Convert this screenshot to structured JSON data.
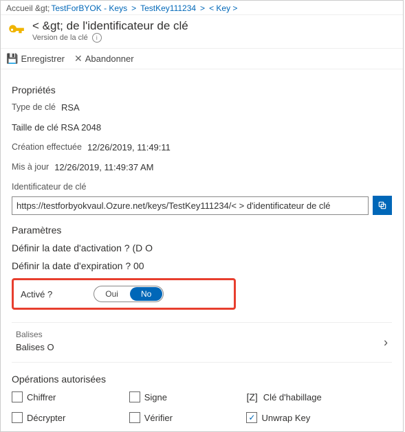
{
  "breadcrumb": {
    "home": "Accueil &gt;",
    "vault": "TestForBYOK - Keys",
    "key": "TestKey111234",
    "current": "< Key >"
  },
  "title": {
    "main": "< &gt; de l'identificateur de clé",
    "sub": "Version de la clé"
  },
  "cmdbar": {
    "save": "Enregistrer",
    "discard": "Abandonner"
  },
  "properties": {
    "heading": "Propriétés",
    "key_type_label": "Type de clé",
    "key_type_value": "RSA",
    "key_size_line": "Taille de clé RSA 2048",
    "created_label": "Création effectuée",
    "created_value": "12/26/2019, 11:49:11",
    "updated_label": "Mis à jour",
    "updated_value": "12/26/2019, 11:49:37 AM",
    "id_label": "Identificateur de clé",
    "id_value": "https://testforbyokvaul.Ozure.net/keys/TestKey111234/< > d'identificateur de clé"
  },
  "settings": {
    "heading": "Paramètres",
    "activation_line": "Définir la date d'activation ? (D O",
    "expiration_line": "Définir la date d'expiration ? 00",
    "enabled_label": "Activé ?",
    "toggle_yes": "Oui",
    "toggle_no": "No"
  },
  "tags": {
    "label": "Balises",
    "value": "Balises O"
  },
  "operations": {
    "heading": "Opérations autorisées",
    "encrypt": "Chiffrer",
    "sign": "Signe",
    "wrap_symbol": "[Z]",
    "wrap": "Clé d'habillage",
    "decrypt": "Décrypter",
    "verify": "Vérifier",
    "unwrap": "Unwrap Key"
  }
}
